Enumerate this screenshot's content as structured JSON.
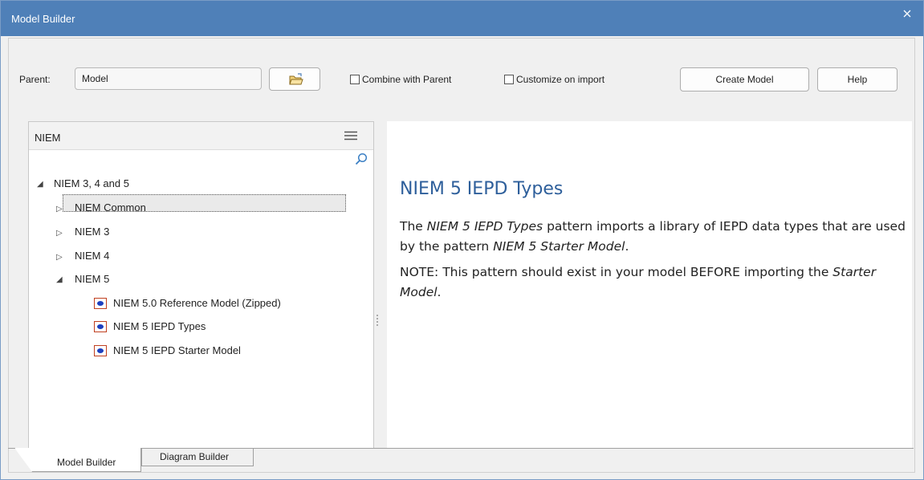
{
  "window": {
    "title": "Model Builder"
  },
  "toolbar": {
    "parent_label": "Parent:",
    "parent_value": "Model",
    "combine_label": "Combine with Parent",
    "combine_checked": false,
    "customize_label": "Customize on import",
    "customize_checked": false,
    "create_button": "Create Model",
    "help_button": "Help"
  },
  "tree": {
    "header": "NIEM",
    "root": {
      "label": "NIEM 3, 4 and 5",
      "expanded": true
    },
    "groups": [
      {
        "label": "NIEM Common",
        "expanded": false
      },
      {
        "label": "NIEM 3",
        "expanded": false
      },
      {
        "label": "NIEM 4",
        "expanded": false
      },
      {
        "label": "NIEM 5",
        "expanded": true
      }
    ],
    "leaves": [
      {
        "label": "NIEM 5.0 Reference Model (Zipped)",
        "selected": false
      },
      {
        "label": "NIEM 5 IEPD Types",
        "selected": true
      },
      {
        "label": "NIEM 5 IEPD Starter Model",
        "selected": false
      }
    ]
  },
  "description": {
    "title": "NIEM 5 IEPD Types",
    "p1_a": "The ",
    "p1_b": "NIEM 5 IEPD Types",
    "p1_c": " pattern imports a library of IEPD data types that are used by the pattern ",
    "p1_d": "NIEM 5 Starter Model",
    "p1_e": ".",
    "p2_a": "NOTE:  This pattern should exist in your model BEFORE importing the ",
    "p2_b": "Starter Model",
    "p2_c": "."
  },
  "tabs": [
    {
      "label": "Model Builder",
      "active": true
    },
    {
      "label": "Diagram Builder",
      "active": false
    }
  ],
  "colors": {
    "titlebar": "#4f80b8",
    "heading": "#2e5f9b",
    "leaf_icon_fill": "#1c3fbf",
    "leaf_icon_border": "#c04020"
  }
}
